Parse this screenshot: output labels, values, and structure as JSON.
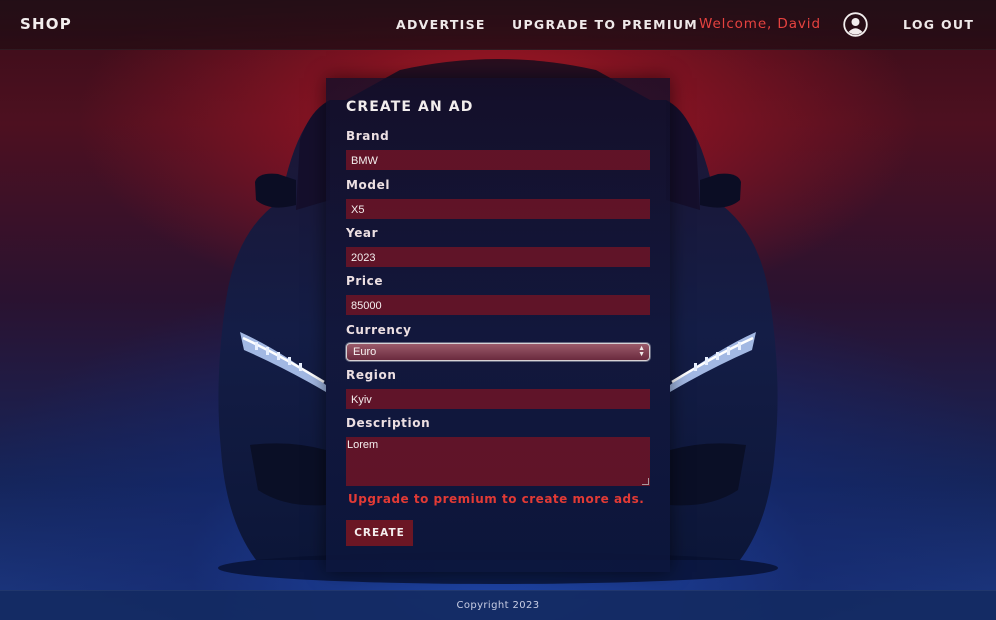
{
  "header": {
    "logo": "SHOP",
    "nav": {
      "advertise": "ADVERTISE",
      "upgrade": "UPGRADE TO PREMIUM",
      "welcome": "Welcome, David",
      "logout": "LOG OUT"
    },
    "user_icon": "user-circle-icon"
  },
  "form": {
    "title": "CREATE AN AD",
    "fields": {
      "brand": {
        "label": "Brand",
        "value": "BMW"
      },
      "model": {
        "label": "Model",
        "value": "X5"
      },
      "year": {
        "label": "Year",
        "value": "2023"
      },
      "price": {
        "label": "Price",
        "value": "85000"
      },
      "currency": {
        "label": "Currency",
        "value": "Euro"
      },
      "region": {
        "label": "Region",
        "value": "Kyiv"
      },
      "description": {
        "label": "Description",
        "value": "Lorem"
      }
    },
    "warning": "Upgrade to premium to create more ads.",
    "submit_label": "CREATE"
  },
  "footer": {
    "copyright": "Copyright 2023"
  },
  "colors": {
    "accent_red": "#e23a35",
    "input_bg": "#6e1426",
    "button_bg": "#6b1624"
  }
}
